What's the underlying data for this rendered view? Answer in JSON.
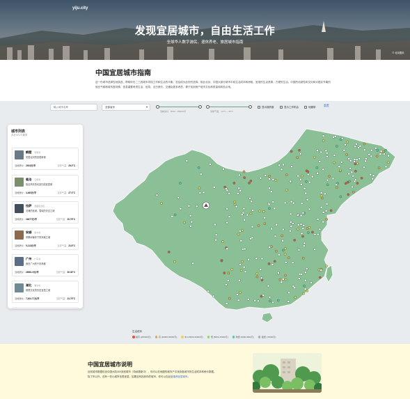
{
  "hero": {
    "brand": "yiju.city",
    "title": "发现宜居城市，自由生活工作",
    "subtitle": "全球华人数字游民、退休养老、旅居城市指南",
    "credit": "© 北京图片"
  },
  "intro": {
    "title": "中国宜居城市指南",
    "body": "这一份城市选择性地挑选、帮助你在二三线城市寻找工作和生活的平衡。总结成为此份的选择。相比北京、中国大部分城市平权生活成本和房租、宜准的生活资源、方便的生活。中国的优越性和文化和对居民节奏的就业气候和城市各特殊，信息重要考虑生活、信息、当日房价、交通及更多考虑、便于找到房产城市文化和质量和风险点地。"
  },
  "filters": {
    "search_placeholder": "输入城市名称",
    "province_value": "全部省份",
    "price_range_label": "当前房价：6000 ~ 80000/平",
    "temp_range_label": "当前气温：-10°C ~ 40°C",
    "toggle_1": "显示拥挤度",
    "toggle_2": "显示工作机会",
    "toggle_3": "地震带",
    "reset": "重置"
  },
  "sidebar": {
    "title": "城市列表",
    "count": "共计371个城市",
    "cards": [
      {
        "name": "鹤壁",
        "prov": "河南省",
        "desc": "安居近河的宜居新城",
        "rent_label": "当地房价：",
        "rent": "2924元/平",
        "temp_label": "当前气温：",
        "temp": "28.3°C",
        "thumb": "#6b7a88"
      },
      {
        "name": "临沧",
        "prov": "云南省",
        "desc": "极边风情的北回归线宜居城",
        "rent_label": "当地房价：",
        "rent": "4,460元/平",
        "temp_label": "当前气温：",
        "temp": "27.0°C",
        "thumb": "#7a8f6a"
      },
      {
        "name": "拉萨",
        "prov": "西藏自治区",
        "desc": "灵魂的圣城，雪域的天空之城",
        "rent_label": "当地房价：",
        "rent": "16677元/平",
        "temp_label": "当前气温：",
        "temp": "20.78°C",
        "thumb": "#43505c"
      },
      {
        "name": "安顺",
        "prov": "贵州省",
        "desc": "黄果树瀑布下的凉爽之城",
        "rent_label": "当地房价：",
        "rent": "5,113元/平",
        "temp_label": "当前气温：",
        "temp": "23.8°C",
        "thumb": "#8c6a4e"
      },
      {
        "name": "广州",
        "prov": "广东省",
        "desc": "食在广州的千年商都",
        "rent_label": "当地房价：",
        "rent": "26581.5元/平",
        "temp_label": "当前气温：",
        "temp": "30.30°C",
        "thumb": "#5a6e8a"
      },
      {
        "name": "湖北",
        "prov": "湖北省",
        "desc": "荆楚文化的历史宜居之城",
        "rent_label": "当地房价：",
        "rent": "7,003.77元/平",
        "temp_label": "当前气温：",
        "temp": "23.75°C",
        "thumb": "#6f8c96"
      },
      {
        "name": "河源",
        "prov": "广东省",
        "desc": "万绿湖畔的生态宜居之城",
        "rent_label": "当地房价：",
        "rent": "",
        "temp_label": "",
        "temp": "",
        "thumb": "#7e9a74"
      }
    ]
  },
  "legend": {
    "title": "生活成本",
    "items": [
      {
        "label": "极高 (≥50000元)",
        "color": "#e0524a"
      },
      {
        "label": "高 (30000-50000元)",
        "color": "#f0a24e"
      },
      {
        "label": "中 (15000-30000元)",
        "color": "#f2d35a"
      },
      {
        "label": "低 (8000-15000元)",
        "color": "#9ad06b"
      },
      {
        "label": "较低 (5000-8000元)",
        "color": "#5cc6a7"
      },
      {
        "label": "极低 (<5000元)",
        "color": "#9eb3c2"
      }
    ]
  },
  "footer": {
    "title": "中国宜居城市说明",
    "body_1": "目前城市数据包含中国大陆300多座城市（持续更新中），你可以在地图的城市产中找到各城市的生活成本和房价数据。",
    "body_2": "除了市以外，还有一些小城市也很宜居，如果没有找到你的城市，你可以在此处",
    "body_link": "推荐宜居城市",
    "body_end": "。"
  },
  "colors": {
    "map_fill": "#8bbf95",
    "map_stroke": "#ffffff",
    "accent": "#3b6fd8",
    "footer_bg": "#fefadb"
  }
}
